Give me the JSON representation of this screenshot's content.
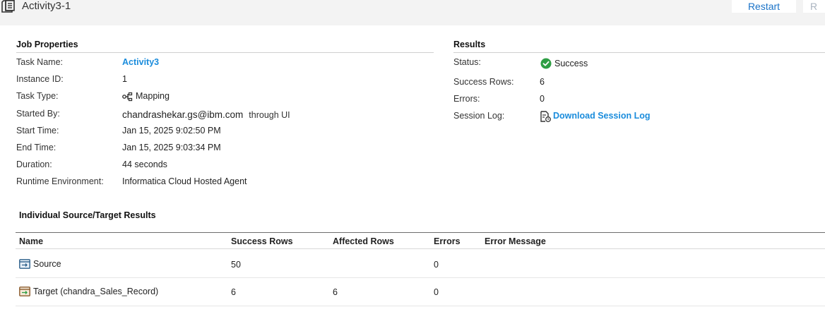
{
  "header": {
    "title": "Activity3-1",
    "restart_label": "Restart",
    "run_label": "R"
  },
  "job_properties": {
    "section_title": "Job Properties",
    "task_name_label": "Task Name:",
    "task_name": "Activity3",
    "instance_id_label": "Instance ID:",
    "instance_id": "1",
    "task_type_label": "Task Type:",
    "task_type": "Mapping",
    "started_by_label": "Started By:",
    "started_by": "chandrashekar.gs@ibm.com",
    "started_via": "through UI",
    "start_time_label": "Start Time:",
    "start_time": "Jan 15, 2025 9:02:50 PM",
    "end_time_label": "End Time:",
    "end_time": "Jan 15, 2025 9:03:34 PM",
    "duration_label": "Duration:",
    "duration": "44 seconds",
    "runtime_env_label": "Runtime Environment:",
    "runtime_env": "Informatica Cloud Hosted Agent"
  },
  "results": {
    "section_title": "Results",
    "status_label": "Status:",
    "status": "Success",
    "success_rows_label": "Success Rows:",
    "success_rows": "6",
    "errors_label": "Errors:",
    "errors": "0",
    "session_log_label": "Session Log:",
    "session_log_link": "Download Session Log",
    "status_color": "#2e9e44"
  },
  "individual": {
    "section_title": "Individual Source/Target Results",
    "columns": {
      "name": "Name",
      "success_rows": "Success Rows",
      "affected_rows": "Affected Rows",
      "errors": "Errors",
      "error_message": "Error Message"
    },
    "rows": [
      {
        "icon": "source-icon",
        "name": "Source",
        "success_rows": "50",
        "affected_rows": "",
        "errors": "0",
        "error_message": ""
      },
      {
        "icon": "target-icon",
        "name": "Target (chandra_Sales_Record)",
        "success_rows": "6",
        "affected_rows": "6",
        "errors": "0",
        "error_message": ""
      }
    ]
  },
  "colors": {
    "link": "#1a8cdc",
    "header_bg": "#f3f3f3",
    "accent_button_text": "#1a73c8"
  }
}
